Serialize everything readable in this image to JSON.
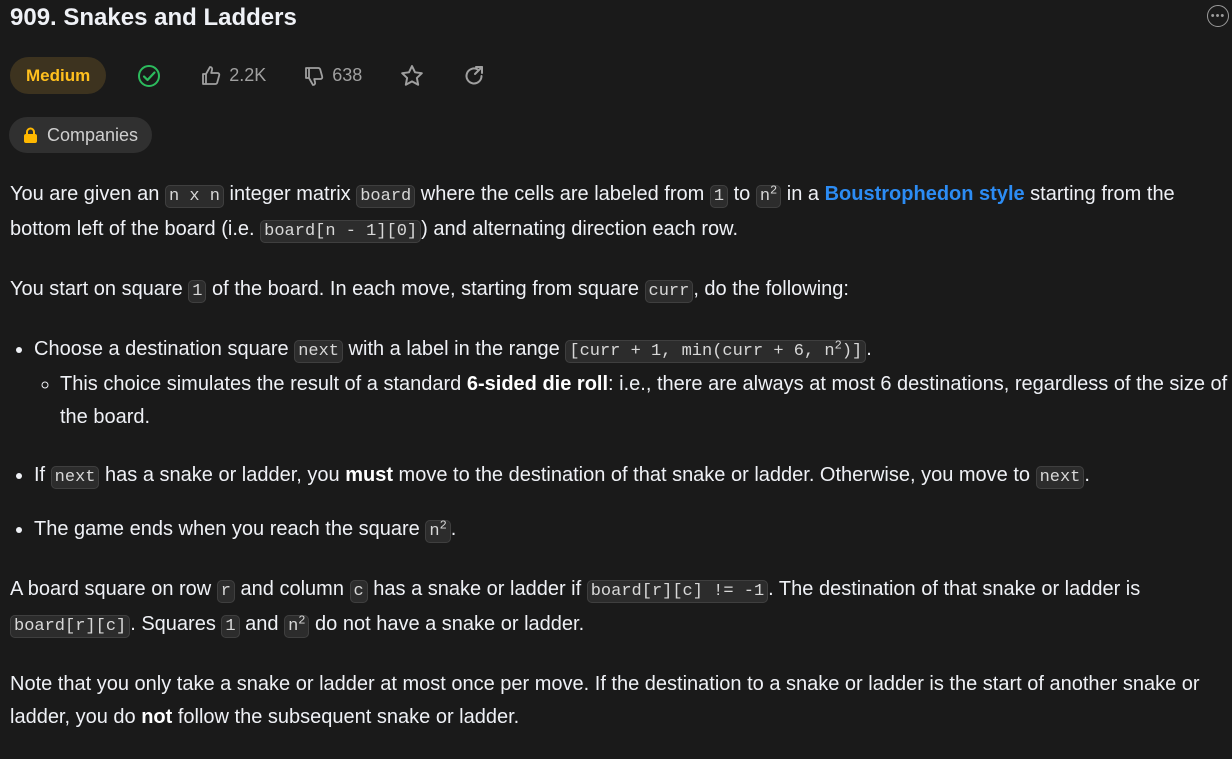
{
  "problem": {
    "title": "909. Snakes and Ladders",
    "difficulty": "Medium",
    "likes": "2.2K",
    "dislikes": "638",
    "companies_label": "Companies"
  },
  "icons": {
    "more": "more-options-icon",
    "solved": "solved-check-icon",
    "like": "thumbs-up-icon",
    "dislike": "thumbs-down-icon",
    "star": "star-icon",
    "share": "share-icon",
    "lock": "lock-icon"
  },
  "colors": {
    "background": "#1a1a1a",
    "medium": "#ffc01e",
    "link": "#2c8cf4",
    "solved": "#2cbb5d"
  },
  "description": {
    "p1": {
      "t1": "You are given an ",
      "c1": "n x n",
      "t2": " integer matrix ",
      "c2": "board",
      "t3": " where the cells are labeled from ",
      "c3": "1",
      "t4": " to ",
      "c4": "n",
      "c4sup": "2",
      "t5": " in a ",
      "link": "Boustrophedon style",
      "t6": " starting from the bottom left of the board (i.e. ",
      "c5": "board[n - 1][0]",
      "t7": ") and alternating direction each row."
    },
    "p2": {
      "t1": "You start on square ",
      "c1": "1",
      "t2": " of the board. In each move, starting from square ",
      "c2": "curr",
      "t3": ", do the following:"
    },
    "bullet1": {
      "t1": "Choose a destination square ",
      "c1": "next",
      "t2": " with a label in the range ",
      "c2": "[curr + 1, min(curr + 6, n",
      "c2sup": "2",
      "c2end": ")]",
      "t3": ".",
      "sub": {
        "t1": "This choice simulates the result of a standard ",
        "b1": "6-sided die roll",
        "t2": ": i.e., there are always at most 6 destinations, regardless of the size of the board."
      }
    },
    "bullet2": {
      "t1": "If ",
      "c1": "next",
      "t2": " has a snake or ladder, you ",
      "b1": "must",
      "t3": " move to the destination of that snake or ladder. Otherwise, you move to ",
      "c2": "next",
      "t4": "."
    },
    "bullet3": {
      "t1": "The game ends when you reach the square ",
      "c1": "n",
      "c1sup": "2",
      "t2": "."
    },
    "p3": {
      "t1": "A board square on row ",
      "c1": "r",
      "t2": " and column ",
      "c2": "c",
      "t3": " has a snake or ladder if ",
      "c3": "board[r][c] != -1",
      "t4": ". The destination of that snake or ladder is ",
      "c4": "board[r][c]",
      "t5": ". Squares ",
      "c5": "1",
      "t6": " and ",
      "c6": "n",
      "c6sup": "2",
      "t7": " do not have a snake or ladder."
    },
    "p4": {
      "t1": "Note that you only take a snake or ladder at most once per move. If the destination to a snake or ladder is the start of another snake or ladder, you do ",
      "b1": "not",
      "t2": " follow the subsequent snake or ladder."
    }
  }
}
